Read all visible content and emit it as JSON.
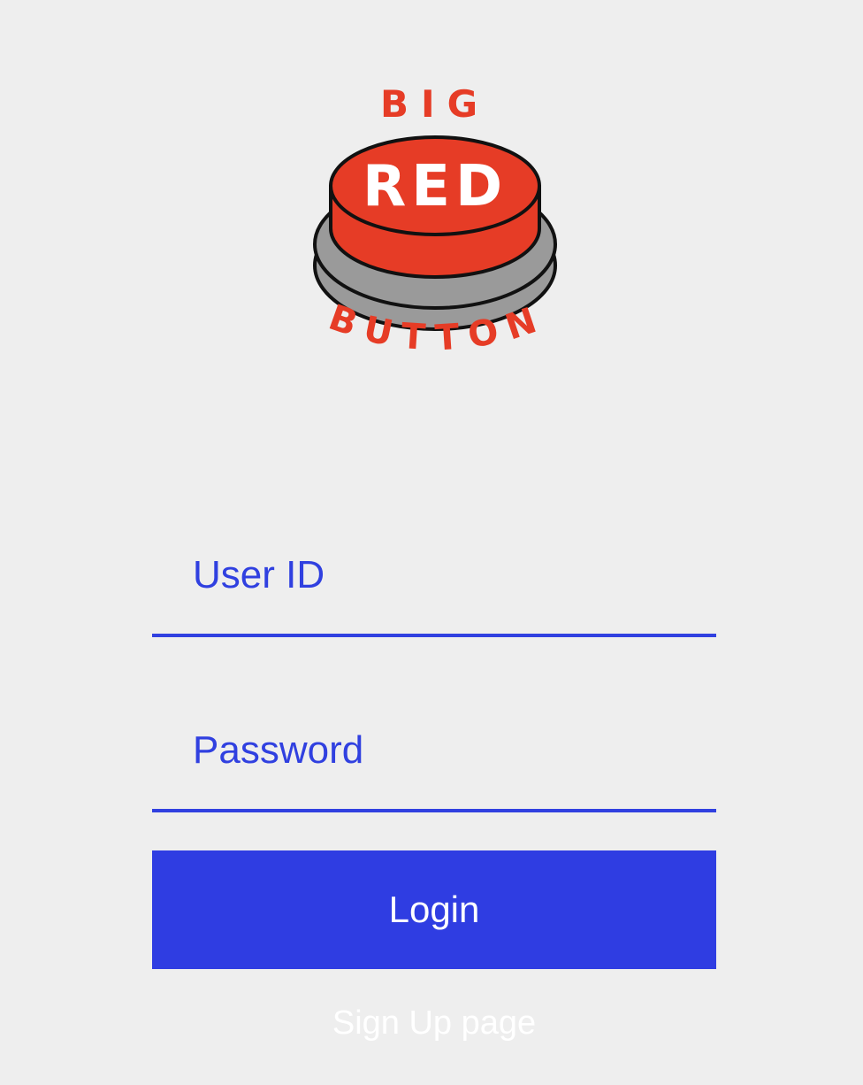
{
  "logo": {
    "line1": "BIG",
    "line2": "RED",
    "line3": "BUTTON",
    "colors": {
      "red": "#e63c26",
      "gray": "#9a9a9a",
      "outline": "#111111",
      "text_on_button": "#ffffff"
    }
  },
  "form": {
    "user_id": {
      "placeholder": "User ID",
      "value": ""
    },
    "password": {
      "placeholder": "Password",
      "value": ""
    },
    "login_label": "Login",
    "signup_label": "Sign Up page"
  },
  "colors": {
    "background": "#eeeeee",
    "accent": "#2f3de2",
    "button_text": "#ffffff"
  }
}
